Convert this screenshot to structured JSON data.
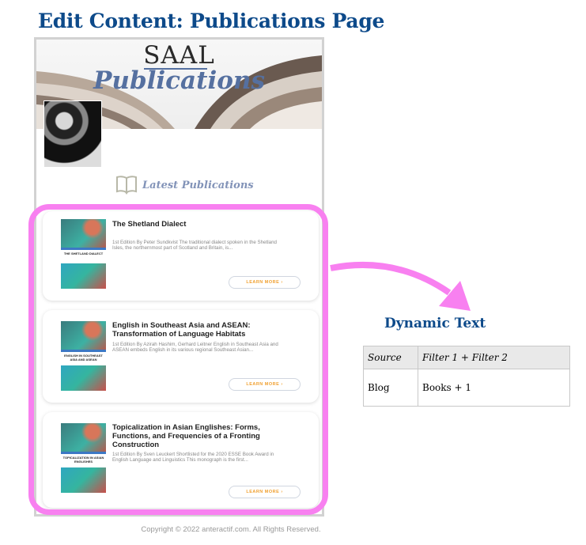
{
  "title": "Edit Content: Publications Page",
  "banner": {
    "brand": "SAAL",
    "heading": "Publications"
  },
  "section_heading": "Latest Publications",
  "cards": [
    {
      "title": "The Shetland Dialect",
      "cover_text": "THE SHETLAND DIALECT",
      "description": "1st Edition By Peter Sundkvist The traditional dialect spoken in the Shetland Isles, the northernmost part of Scotland and Britain, is...",
      "button": "LEARN MORE ›"
    },
    {
      "title": "English in Southeast Asia and ASEAN: Transformation of Language Habitats",
      "cover_text": "ENGLISH IN SOUTHEAST ASIA AND ASEAN",
      "description": "1st Edition By Azirah Hashim, Gerhard Leitner English in Southeast Asia and ASEAN embeds English in its various regional Southeast Asian...",
      "button": "LEARN MORE ›"
    },
    {
      "title": "Topicalization in Asian Englishes: Forms, Functions, and Frequencies of a Fronting Construction",
      "cover_text": "TOPICALIZATION IN ASIAN ENGLISHES",
      "description": "1st Edition By Sven Leuckert Shortlisted for the 2020 ESSE Book Award in English Language and Linguistics This monograph is the first...",
      "button": "LEARN MORE ›"
    }
  ],
  "footer": "Copyright © 2022 anteractif.com. All Rights Reserved.",
  "dynamic": {
    "heading": "Dynamic Text",
    "headers": [
      "Source",
      "Filter 1 + Filter 2"
    ],
    "row": [
      "Blog",
      "Books + 1"
    ]
  },
  "colors": {
    "highlight": "#f880f0",
    "heading": "#0d4a8a"
  }
}
